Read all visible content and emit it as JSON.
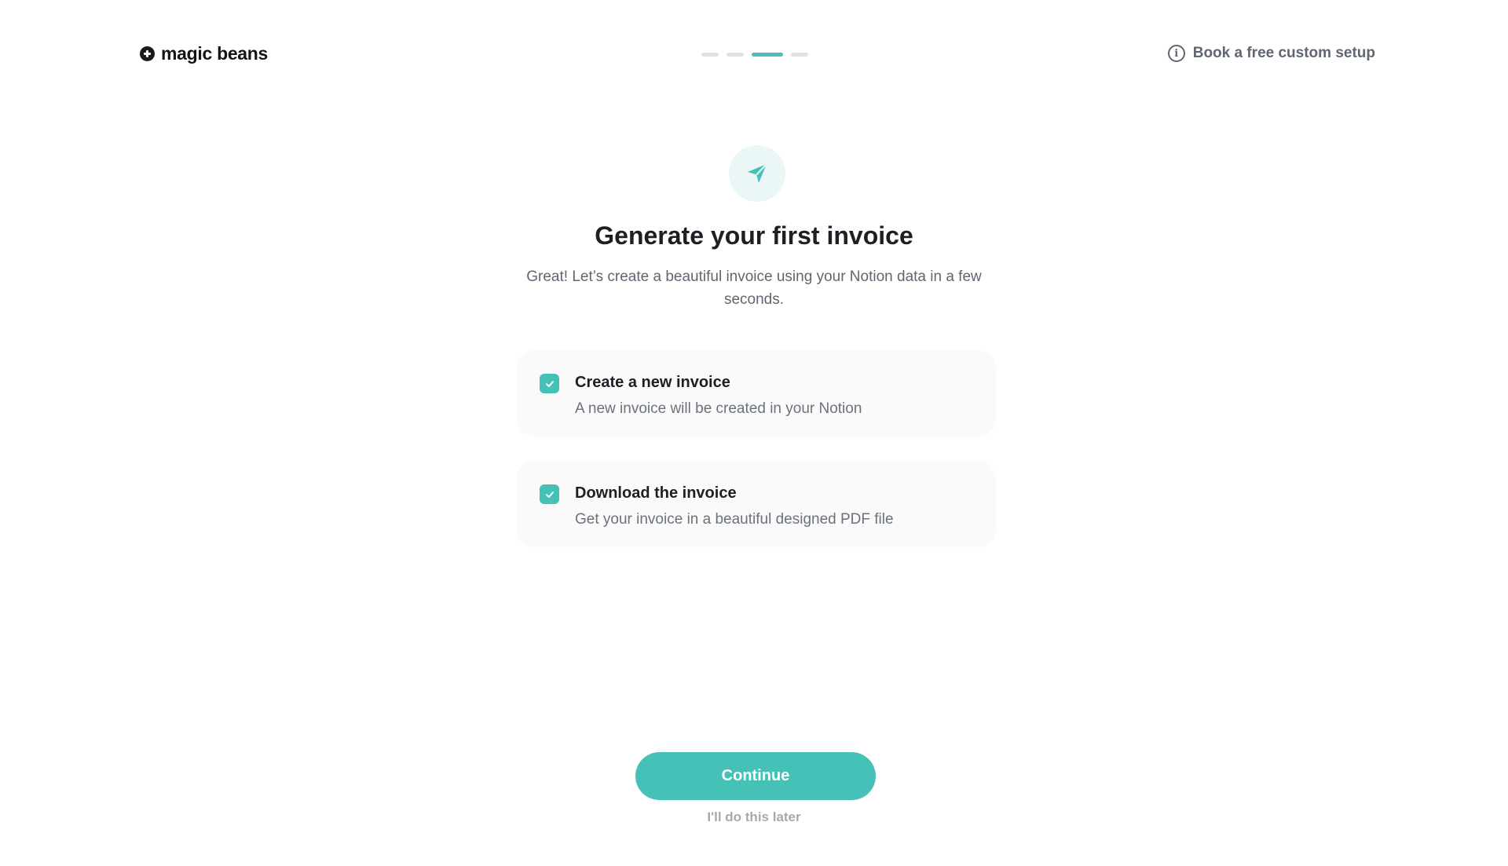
{
  "header": {
    "logo_text": "magic beans",
    "help_link": "Book a free custom setup",
    "progress": {
      "total_steps": 4,
      "current_step": 3
    }
  },
  "hero": {
    "icon": "paper-plane-icon",
    "title": "Generate your first invoice",
    "subtitle": "Great! Let’s create a beautiful invoice using your Notion data in a few seconds."
  },
  "options": [
    {
      "title": "Create a new invoice",
      "description": "A new invoice will be created in your Notion",
      "checked": true
    },
    {
      "title": "Download the invoice",
      "description": "Get your invoice in a beautiful designed PDF file",
      "checked": true
    }
  ],
  "actions": {
    "continue_label": "Continue",
    "later_label": "I'll do this later"
  },
  "colors": {
    "accent": "#45c1b8",
    "accent_soft": "#ebf7f6",
    "card_bg": "#fafafa",
    "muted_text": "#5f6671"
  }
}
